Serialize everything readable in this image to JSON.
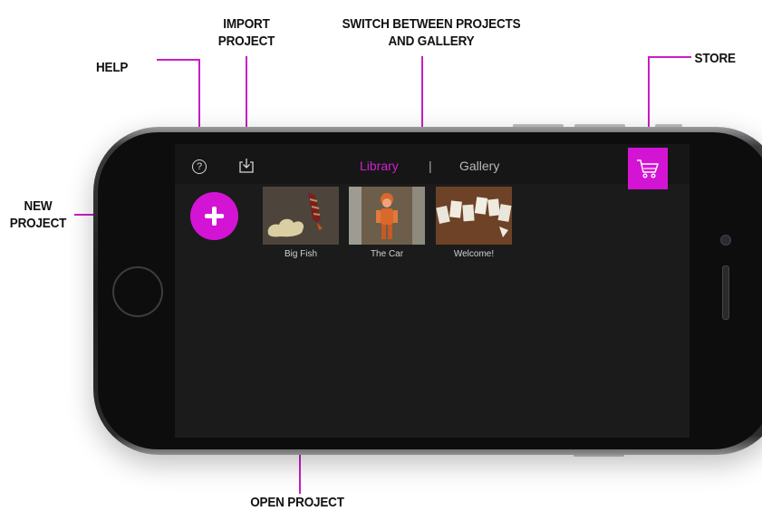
{
  "callouts": {
    "help": "HELP",
    "import_line1": "IMPORT",
    "import_line2": "PROJECT",
    "switch_line1": "SWITCH BETWEEN PROJECTS",
    "switch_line2": "AND GALLERY",
    "store": "STORE",
    "new_line1": "NEW",
    "new_line2": "PROJECT",
    "open": "OPEN PROJECT"
  },
  "navbar": {
    "help_glyph": "?",
    "tabs": {
      "library": "Library",
      "separator": "|",
      "gallery": "Gallery"
    },
    "active_tab": "Library"
  },
  "projects": [
    {
      "title": "Big Fish"
    },
    {
      "title": "The Car"
    },
    {
      "title": "Welcome!"
    }
  ],
  "icons": {
    "help": "question-circle-icon",
    "import": "import-tray-icon",
    "store": "shopping-cart-icon",
    "new": "plus-icon"
  },
  "colors": {
    "accent": "#d414d4",
    "callout_line": "#c81ec8",
    "screen_bg": "#1b1b1b"
  }
}
